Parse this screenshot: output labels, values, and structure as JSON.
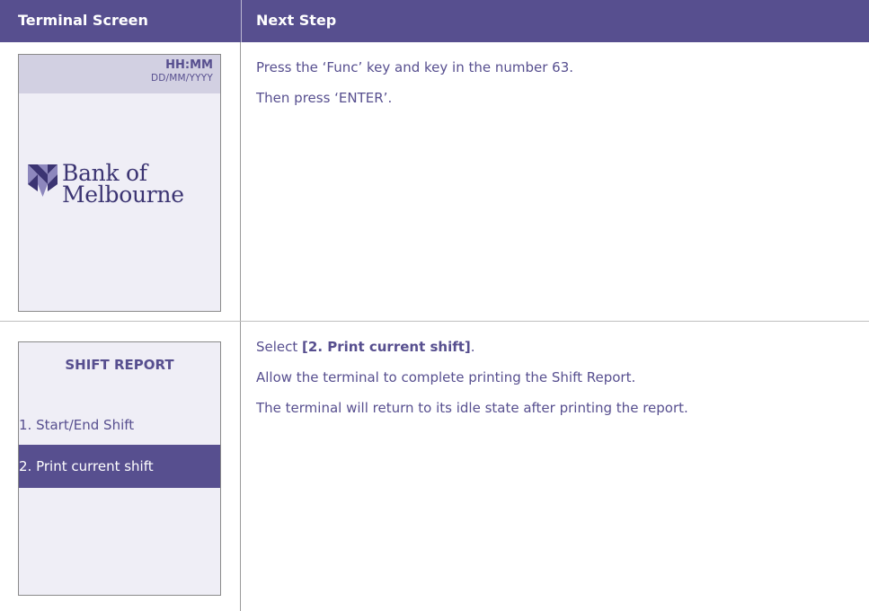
{
  "header": {
    "col1": "Terminal Screen",
    "col2": "Next Step"
  },
  "screen1": {
    "time": "HH:MM",
    "date": "DD/MM/YYYY",
    "logo_line1": "Bank of",
    "logo_line2": "Melbourne"
  },
  "steps1": {
    "line1": "Press the ‘Func’ key and key in the number 63.",
    "line2": "Then press ‘ENTER’."
  },
  "screen2": {
    "title": "SHIFT REPORT",
    "option1": "1. Start/End Shift",
    "option2": "2. Print current shift"
  },
  "steps2": {
    "line1_prefix": "Select ",
    "line1_bold": "[2. Print current shift]",
    "line1_suffix": ".",
    "line2": "Allow the terminal to complete printing the Shift Report.",
    "line3": "The terminal will return to its idle state after printing the report."
  },
  "colors": {
    "brand": "#574f8f",
    "screen_bg": "#efeef6",
    "screen_topbar": "#d2d0e2",
    "logo_dark": "#3b3472"
  },
  "icons": [
    "bank-of-melbourne-logo-icon"
  ]
}
